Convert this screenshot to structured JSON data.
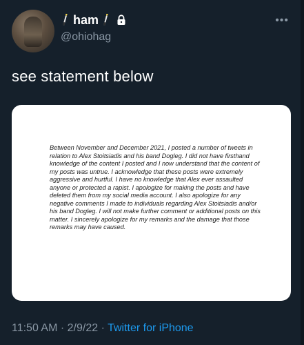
{
  "user": {
    "display_name": "ham",
    "handle": "@ohiohag",
    "name_emoji_icon": "magic-wand-icon",
    "protected_icon": "lock-icon"
  },
  "tweet": {
    "text": "see statement below",
    "statement_image": {
      "text": "Between November and December 2021, I posted a number of tweets in relation to Alex Stoitsiadis and his band Dogleg. I did not have firsthand knowledge of the content I posted and I now understand that the content of my posts was untrue. I acknowledge that these posts were extremely aggressive and hurtful. I have no knowledge that Alex ever assaulted anyone or protected a rapist.  I apologize for making the posts and have deleted them from my social media account.  I also apologize for any negative comments I made to individuals regarding Alex Stoitsiadis and/or his band Dogleg.  I will not make further comment or additional posts on this matter.  I sincerely apologize for my remarks and the damage that those remarks may have caused."
    }
  },
  "meta": {
    "time": "11:50 AM",
    "date": "2/9/22",
    "separator": "·",
    "source": "Twitter for iPhone"
  },
  "more_label": "•••",
  "colors": {
    "background": "#15202b",
    "secondary_text": "#8b98a5",
    "link": "#1d9bf0"
  }
}
